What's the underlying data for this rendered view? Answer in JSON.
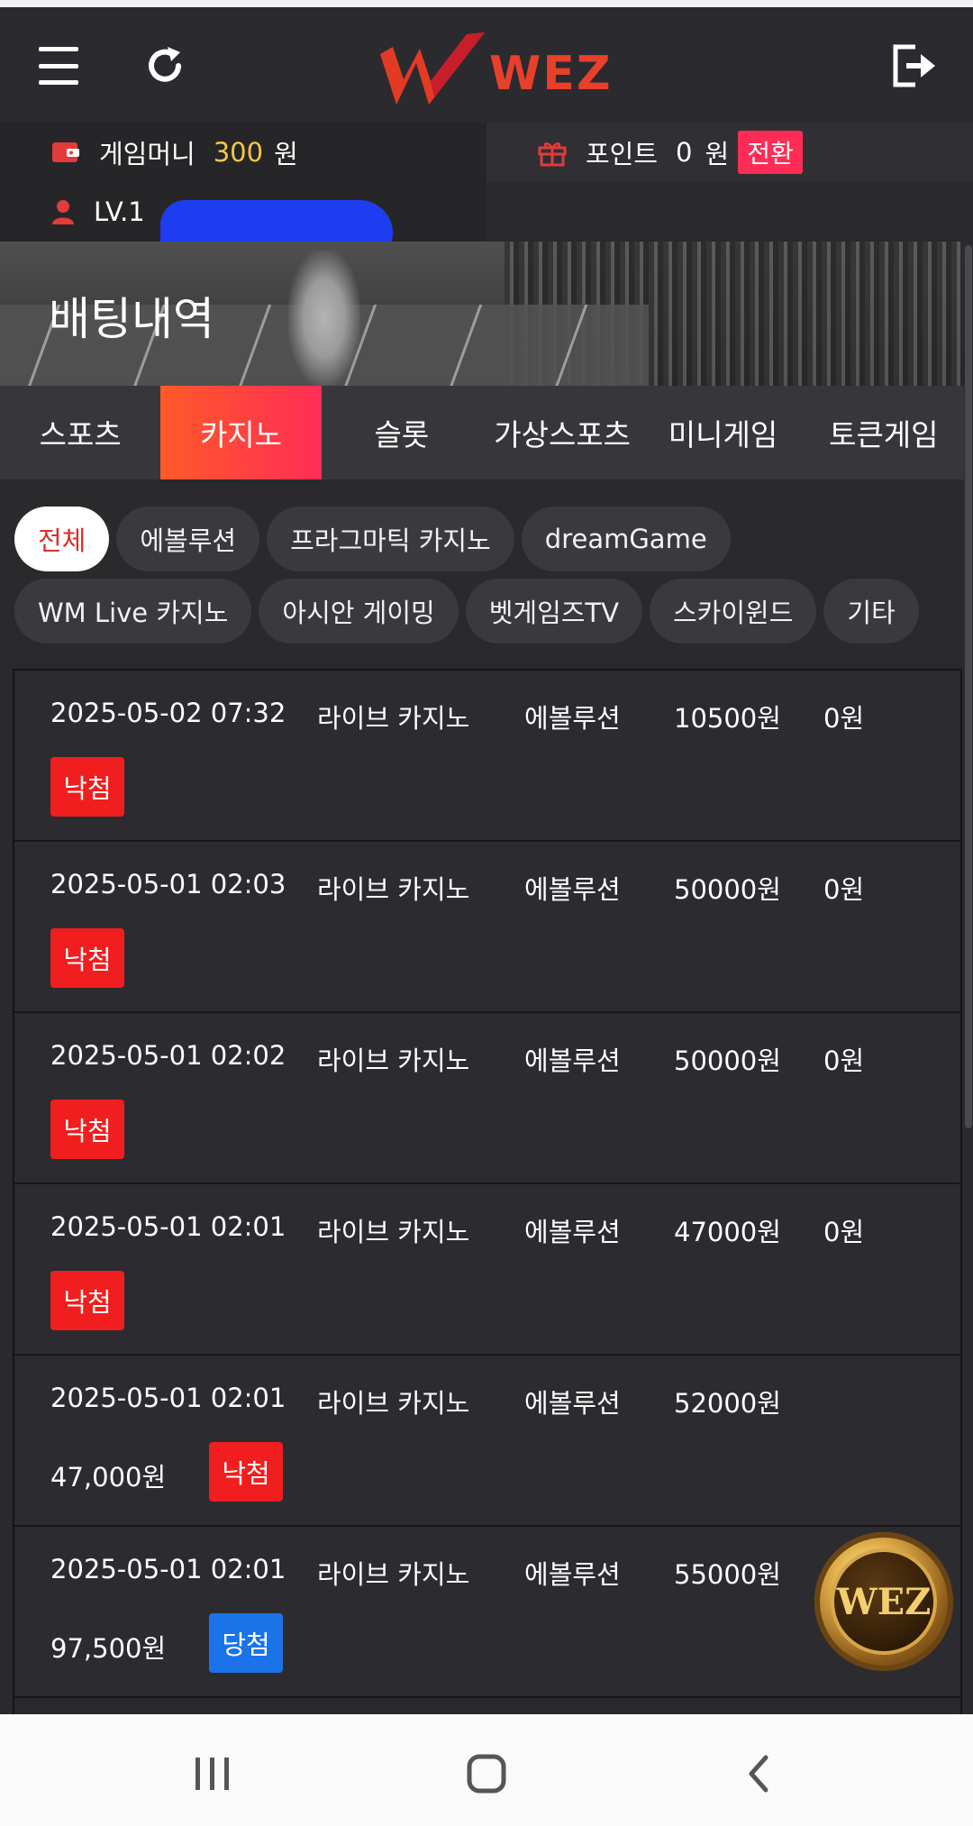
{
  "header": {
    "logo_text": "WEZ"
  },
  "info": {
    "game_money_label": "게임머니",
    "game_money_value": "300",
    "game_money_unit": "원",
    "point_label": "포인트",
    "point_value": "0",
    "point_unit": "원",
    "convert_label": "전환",
    "level": "LV.1"
  },
  "banner": {
    "title": "배팅내역"
  },
  "tabs": [
    "스포츠",
    "카지노",
    "슬롯",
    "가상스포츠",
    "미니게임",
    "토큰게임"
  ],
  "filters": {
    "row1": [
      "전체",
      "에볼루션",
      "프라그마틱 카지노",
      "dreamGame"
    ],
    "row2": [
      "WM Live 카지노",
      "아시안 게이밍",
      "벳게임즈TV",
      "스카이윈드",
      "기타"
    ]
  },
  "rows": [
    {
      "datetime": "2025-05-02 07:32",
      "type": "라이브 카지노",
      "game": "에볼루션",
      "bet": "10500원",
      "win": "0원",
      "status": "낙첨"
    },
    {
      "datetime": "2025-05-01 02:03",
      "type": "라이브 카지노",
      "game": "에볼루션",
      "bet": "50000원",
      "win": "0원",
      "status": "낙첨"
    },
    {
      "datetime": "2025-05-01 02:02",
      "type": "라이브 카지노",
      "game": "에볼루션",
      "bet": "50000원",
      "win": "0원",
      "status": "낙첨"
    },
    {
      "datetime": "2025-05-01 02:01",
      "type": "라이브 카지노",
      "game": "에볼루션",
      "bet": "47000원",
      "win": "0원",
      "status": "낙첨"
    },
    {
      "datetime": "2025-05-01 02:01",
      "type": "라이브 카지노",
      "game": "에볼루션",
      "bet": "52000원",
      "payout": "47,000원",
      "status": "낙첨"
    },
    {
      "datetime": "2025-05-01 02:01",
      "type": "라이브 카지노",
      "game": "에볼루션",
      "bet": "55000원",
      "payout": "97,500원",
      "status": "당첨"
    }
  ],
  "floating_button": {
    "text": "WEZ"
  },
  "colors": {
    "accent": "#ff2d55",
    "lose": "#f01e1e",
    "win": "#1a73e8",
    "money": "#f2c744"
  }
}
